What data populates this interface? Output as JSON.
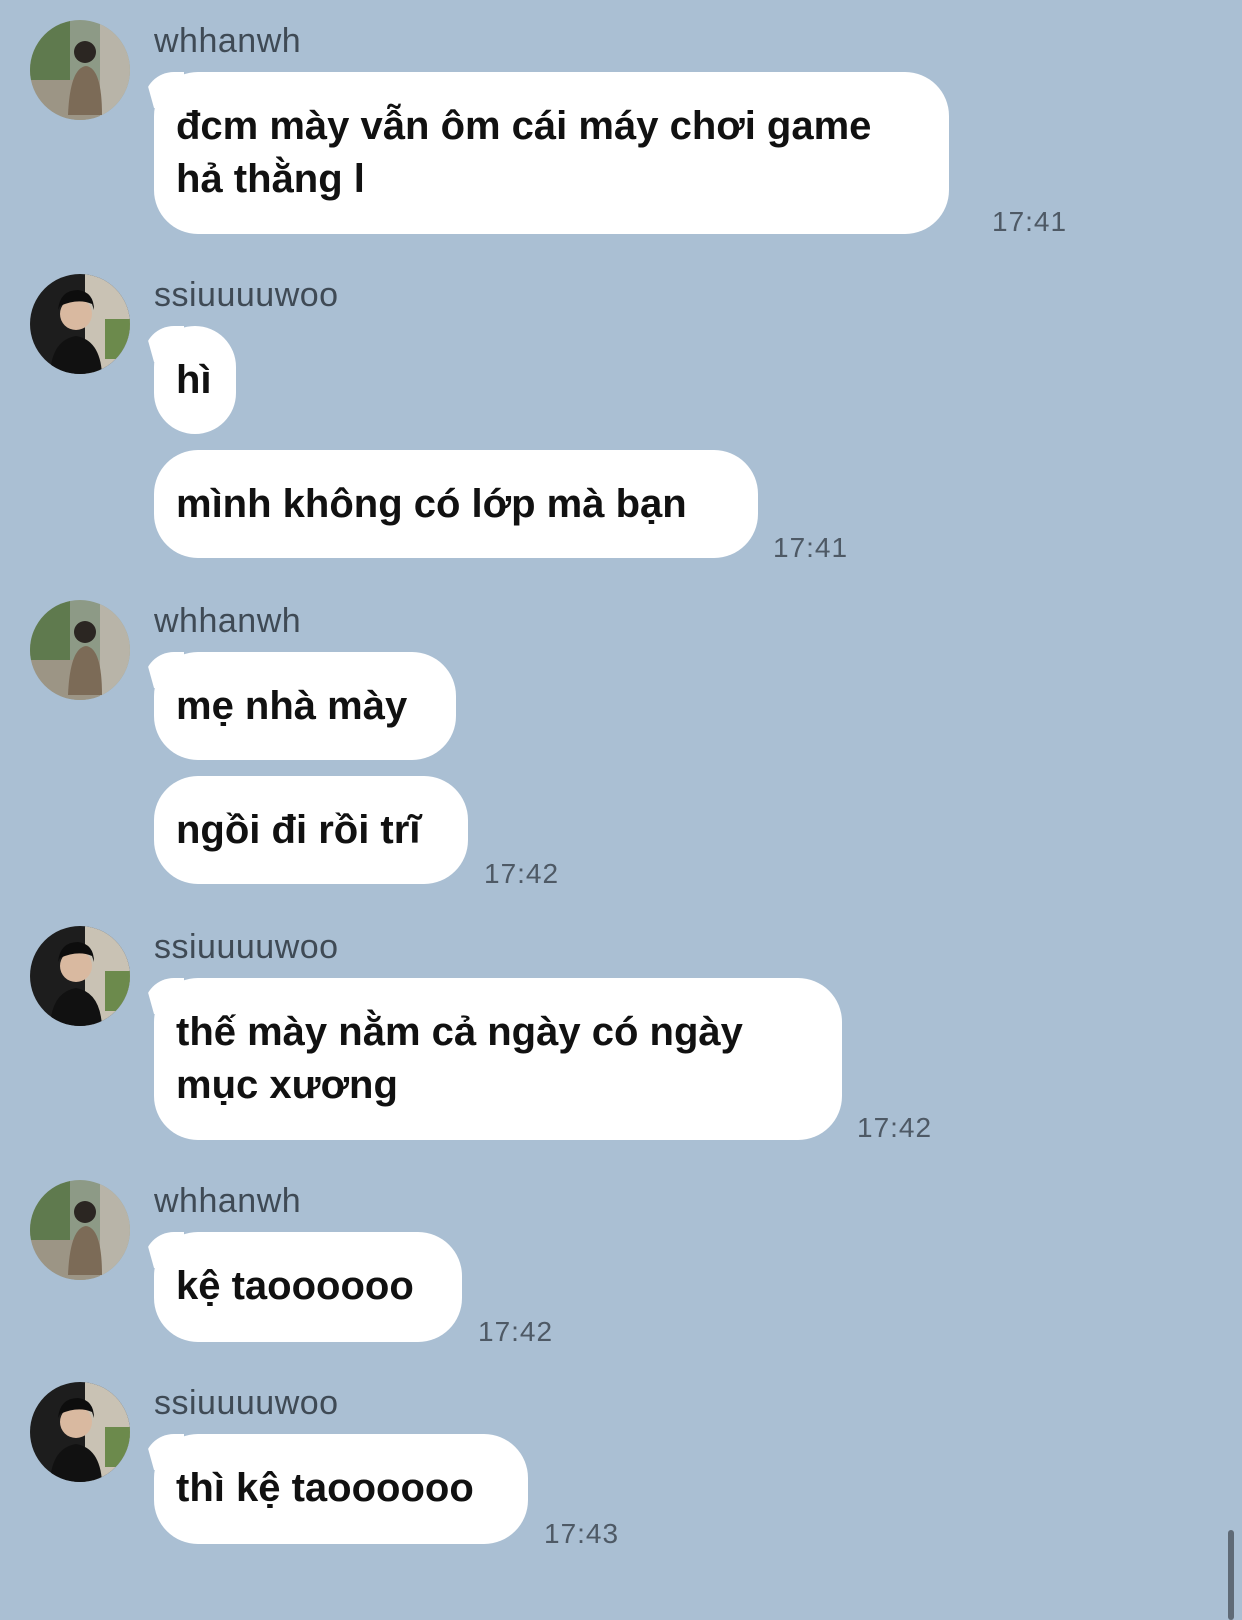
{
  "chat": {
    "messages": [
      {
        "sender": "whhanwh",
        "avatar_icon": "user-avatar-whhanwh-icon",
        "bubbles": [
          "đcm mày vẫn ôm cái máy chơi game\nhả thằng l"
        ],
        "time": "17:41"
      },
      {
        "sender": "ssiuuuuwoo",
        "avatar_icon": "user-avatar-ssiuuuuwoo-icon",
        "bubbles": [
          "hì",
          "mình không có lớp mà bạn"
        ],
        "time": "17:41"
      },
      {
        "sender": "whhanwh",
        "avatar_icon": "user-avatar-whhanwh-icon",
        "bubbles": [
          "mẹ nhà mày",
          "ngồi đi rồi trĩ"
        ],
        "time": "17:42"
      },
      {
        "sender": "ssiuuuuwoo",
        "avatar_icon": "user-avatar-ssiuuuuwoo-icon",
        "bubbles": [
          "thế mày nằm cả ngày có ngày\nmục xương"
        ],
        "time": "17:42"
      },
      {
        "sender": "whhanwh",
        "avatar_icon": "user-avatar-whhanwh-icon",
        "bubbles": [
          "kệ taoooooo"
        ],
        "time": "17:42"
      },
      {
        "sender": "ssiuuuuwoo",
        "avatar_icon": "user-avatar-ssiuuuuwoo-icon",
        "bubbles": [
          "thì kệ taoooooo"
        ],
        "time": "17:43"
      }
    ]
  },
  "colors": {
    "background": "#aabfd3",
    "bubble": "#ffffff",
    "sender_text": "#3f4a55",
    "time_text": "#4e5965"
  }
}
